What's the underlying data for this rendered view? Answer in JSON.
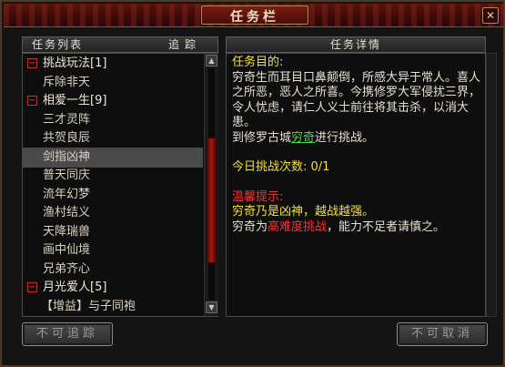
{
  "window": {
    "title": "任务栏",
    "close_icon": "close-icon"
  },
  "left_panel": {
    "header_title": "任务列表",
    "header_track": "追踪",
    "items": [
      {
        "type": "category",
        "label": "挑战玩法[1]",
        "expanded": true
      },
      {
        "type": "quest",
        "label": "斥除非天"
      },
      {
        "type": "category",
        "label": "相爱一生[9]",
        "expanded": true
      },
      {
        "type": "quest",
        "label": "三才灵阵"
      },
      {
        "type": "quest",
        "label": "共贺良辰"
      },
      {
        "type": "quest",
        "label": "剑指凶神",
        "selected": true
      },
      {
        "type": "quest",
        "label": "普天同庆"
      },
      {
        "type": "quest",
        "label": "流年幻梦"
      },
      {
        "type": "quest",
        "label": "渔村结义"
      },
      {
        "type": "quest",
        "label": "天降瑞兽"
      },
      {
        "type": "quest",
        "label": "画中仙境"
      },
      {
        "type": "quest",
        "label": "兄弟齐心"
      },
      {
        "type": "category",
        "label": "月光爱人[5]",
        "expanded": true
      },
      {
        "type": "quest",
        "label": "【增益】与子同袍"
      }
    ],
    "expander_symbol": "⊟"
  },
  "right_panel": {
    "header_title": "任务详情",
    "goal_label": "任务目的:",
    "desc_line1": "穷奇生而耳目口鼻颠倒，所感大异于常人。喜人之所恶，恶人之所喜。今携修罗大军侵扰三界，令人忧虑，请仁人义士前往将其击杀，以消大患。",
    "desc_go_prefix": "到修罗古城",
    "desc_go_link": "穷奇",
    "desc_go_suffix": "进行挑战。",
    "daily_label": "今日挑战次数: 0/1",
    "tip_label": "温馨提示:",
    "tip_line1": "穷奇乃是凶神，越战越强。",
    "tip_line2_prefix": "穷奇为",
    "tip_line2_highlight": "高难度挑战",
    "tip_line2_suffix": "，能力不足者请慎之。"
  },
  "buttons": {
    "track": "不可追踪",
    "cancel": "不可取消"
  },
  "colors": {
    "accent_red": "#a01810",
    "text_yellow": "#f0e040",
    "text_red": "#ff3030",
    "text_green": "#40e040"
  }
}
